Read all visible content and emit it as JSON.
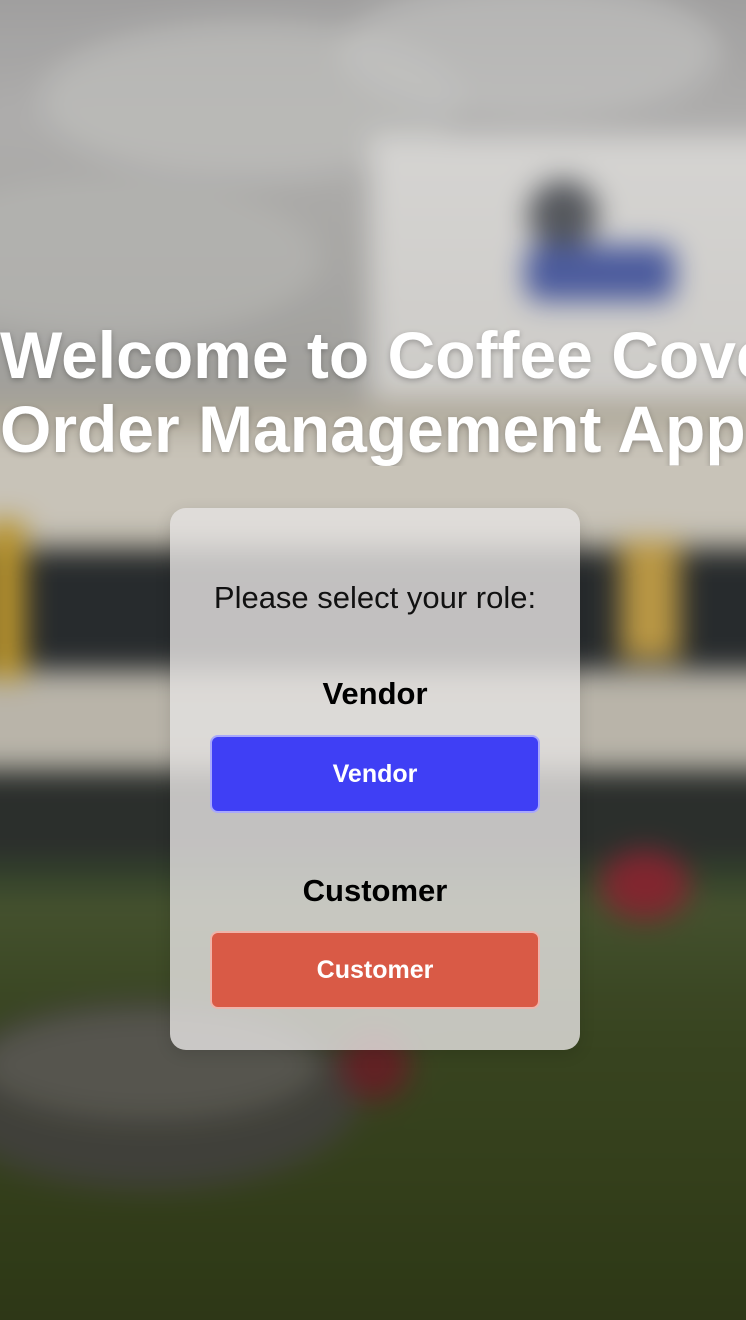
{
  "title": {
    "line1": "Welcome to Coffee Cove",
    "line2": "Order Management App!"
  },
  "role_card": {
    "prompt": "Please select your role:",
    "vendor": {
      "heading": "Vendor",
      "button_label": "Vendor",
      "color": "#3f3ff5"
    },
    "customer": {
      "heading": "Customer",
      "button_label": "Customer",
      "color": "#d95a46"
    }
  },
  "background": {
    "description_icon": "blurred-building-photo"
  }
}
